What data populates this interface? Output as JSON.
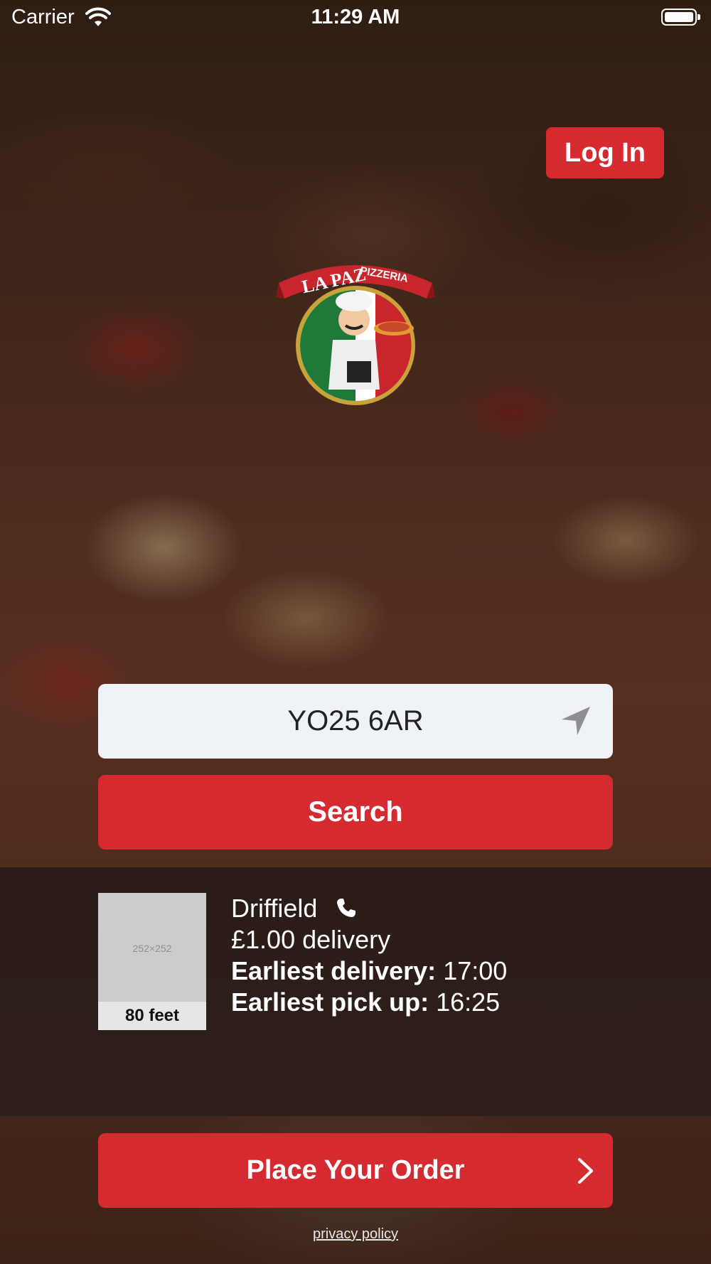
{
  "status_bar": {
    "carrier": "Carrier",
    "time": "11:29 AM"
  },
  "header": {
    "login_label": "Log In"
  },
  "logo": {
    "brand_top": "LA PAZ",
    "brand_sub": "PIZZERIA"
  },
  "search": {
    "postcode_value": "YO25 6AR",
    "button_label": "Search",
    "locate_icon": "location-arrow-icon"
  },
  "store": {
    "thumbnail_placeholder": "252×252",
    "distance": "80 feet",
    "name": "Driffield",
    "phone_icon": "phone-icon",
    "delivery_fee": "£1.00 delivery",
    "earliest_delivery_label": "Earliest delivery:",
    "earliest_delivery_time": "17:00",
    "earliest_pickup_label": "Earliest pick up:",
    "earliest_pickup_time": "16:25"
  },
  "order": {
    "button_label": "Place Your Order"
  },
  "footer": {
    "privacy_label": "privacy policy"
  },
  "colors": {
    "accent": "#d62a31",
    "input_bg": "#eff2f7",
    "panel_bg": "#2b1c17"
  }
}
